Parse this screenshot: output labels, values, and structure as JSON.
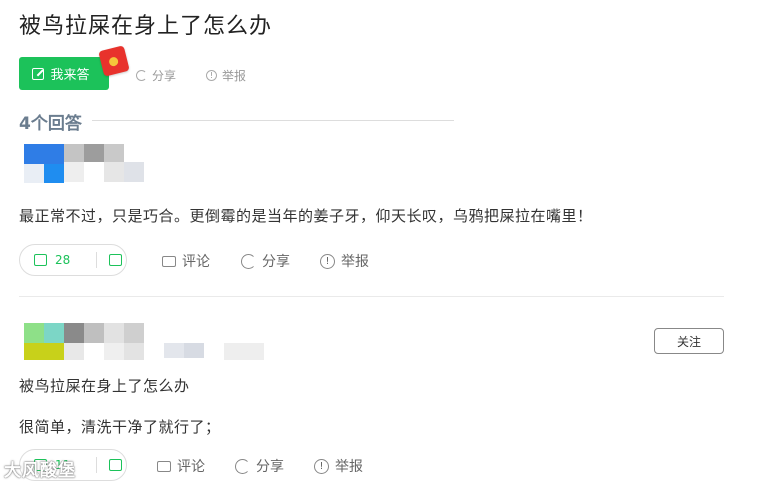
{
  "question": {
    "title": "被鸟拉屎在身上了怎么办",
    "answer_button_label": "我来答",
    "share_label": "分享",
    "report_label": "举报"
  },
  "answers_count_label": "4个回答",
  "answers": [
    {
      "text": "最正常不过，只是巧合。更倒霉的是当年的姜子牙，仰天长叹，乌鸦把屎拉在嘴里！",
      "likes": "28",
      "comment_label": "评论",
      "share_label": "分享",
      "report_label": "举报"
    },
    {
      "follow_label": "关注",
      "quote": "被鸟拉屎在身上了怎么办",
      "text": "很简单，清洗干净了就行了；",
      "likes": "11",
      "comment_label": "评论",
      "share_label": "分享",
      "report_label": "举报"
    }
  ],
  "watermark": "大风酸堡",
  "colors": {
    "accent": "#1cc25a",
    "count": "#6b7d8f",
    "redpacket": "#e8322c"
  },
  "icons": [
    "edit-icon",
    "red-packet-icon",
    "share-icon",
    "report-icon",
    "thumb-up-icon",
    "thumb-down-icon",
    "comment-icon"
  ]
}
